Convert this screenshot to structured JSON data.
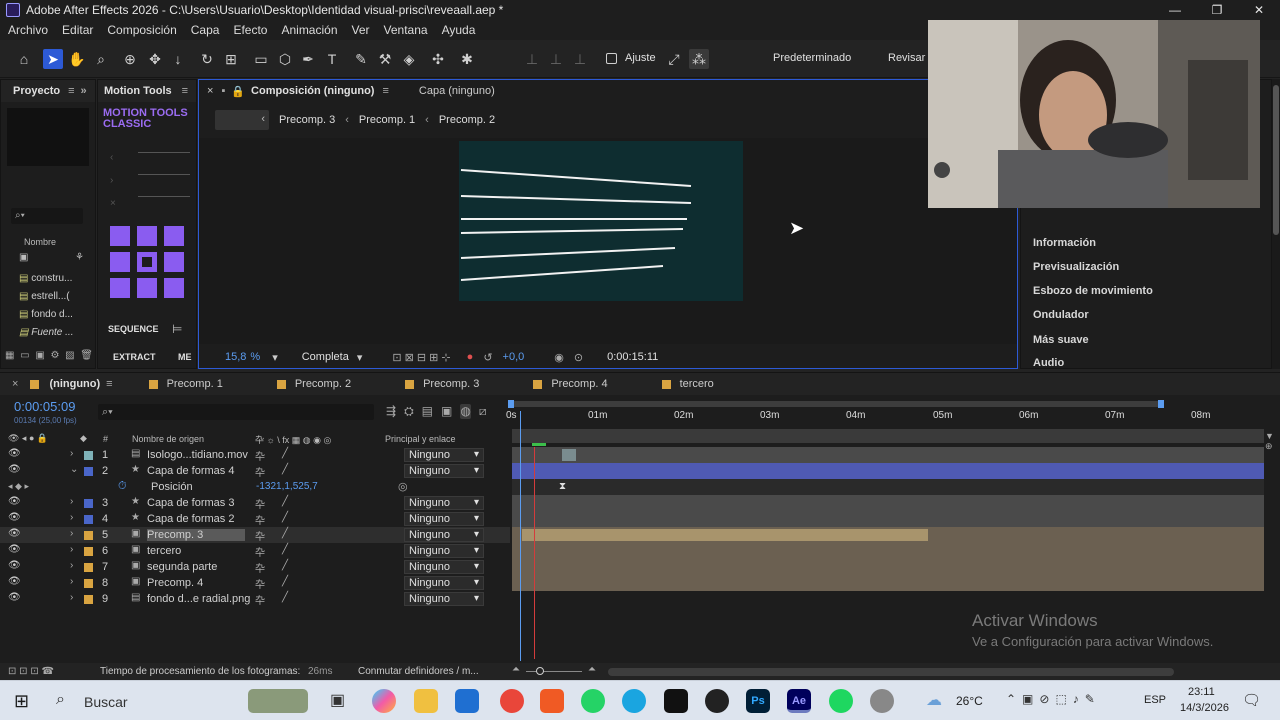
{
  "window": {
    "title": "Adobe After Effects 2026 - C:\\Users\\Usuario\\Desktop\\Identidad visual-prisci\\reveaall.aep *",
    "controls": [
      "—",
      "❐",
      "✕"
    ]
  },
  "menu": [
    "Archivo",
    "Editar",
    "Composición",
    "Capa",
    "Efecto",
    "Animación",
    "Ver",
    "Ventana",
    "Ayuda"
  ],
  "toolbar": {
    "snap_label": "Ajuste",
    "workspace": "Predeterminado",
    "review": "Revisar"
  },
  "project_panel": {
    "title": "Proyecto",
    "search_placeholder": "",
    "column": "Nombre",
    "items": [
      "constru...",
      "estrell...(",
      "fondo d...",
      "Fuente ..."
    ]
  },
  "motion_tools": {
    "title": "Motion Tools",
    "brand_line1": "MOTION TOOLS",
    "brand_line2": "CLASSIC",
    "sequence": "SEQUENCE",
    "extract": "EXTRACT",
    "me": "ME"
  },
  "composition": {
    "tab_title": "Composición (ninguno)",
    "layer_tab": "Capa (ninguno)",
    "breadcrumbs": [
      "Precomp. 3",
      "Precomp. 1",
      "Precomp. 2"
    ],
    "zoom": "15,8",
    "zoom_unit": "%",
    "resolution": "Completa",
    "exposure": "+0,0",
    "timecode": "0:00:15:11"
  },
  "effects_panel": {
    "items": [
      "Información",
      "Previsualización",
      "Esbozo de movimiento",
      "Ondulador",
      "Más suave",
      "Audio"
    ]
  },
  "timeline": {
    "tabs": [
      "(ninguno)",
      "Precomp. 1",
      "Precomp. 2",
      "Precomp. 3",
      "Precomp. 4",
      "tercero"
    ],
    "tab_colors": [
      "#e0a040",
      "#d9a441",
      "#d9a441",
      "#d9a441",
      "#d9a441",
      "#d9a441"
    ],
    "timecode": "0:00:05:09",
    "timecode_sub": "00134 (25,00 fps)",
    "col_source": "Nombre de origen",
    "col_hash": "#",
    "col_parent": "Principal y enlace",
    "ruler": [
      "0s",
      "01m",
      "02m",
      "03m",
      "04m",
      "05m",
      "06m",
      "07m",
      "08m"
    ],
    "layers": [
      {
        "num": "1",
        "name": "Isologo...tidiano.mov",
        "color": "#7fb2b8",
        "parent": "Ninguno",
        "icon": "footage-icon"
      },
      {
        "num": "2",
        "name": "Capa de formas 4",
        "color": "#4a66c9",
        "parent": "Ninguno",
        "icon": "star-icon"
      },
      {
        "num": "3",
        "name": "Capa de formas 3",
        "color": "#4a66c9",
        "parent": "Ninguno",
        "icon": "star-icon"
      },
      {
        "num": "4",
        "name": "Capa de formas 2",
        "color": "#4a66c9",
        "parent": "Ninguno",
        "icon": "star-icon"
      },
      {
        "num": "5",
        "name": "Precomp. 3",
        "color": "#d9a441",
        "parent": "Ninguno",
        "icon": "comp-icon"
      },
      {
        "num": "6",
        "name": "tercero",
        "color": "#d9a441",
        "parent": "Ninguno",
        "icon": "comp-icon"
      },
      {
        "num": "7",
        "name": "segunda parte",
        "color": "#d9a441",
        "parent": "Ninguno",
        "icon": "comp-icon"
      },
      {
        "num": "8",
        "name": "Precomp. 4",
        "color": "#d9a441",
        "parent": "Ninguno",
        "icon": "comp-icon"
      },
      {
        "num": "9",
        "name": "fondo d...e radial.png",
        "color": "#d9a441",
        "parent": "Ninguno",
        "icon": "image-icon"
      }
    ],
    "position_prop": {
      "label": "Posición",
      "value": "-1321,1,525,7"
    },
    "status": "Tiempo de procesamiento de los fotogramas:",
    "status_value": "26ms",
    "toggle": "Conmutar definidores / m..."
  },
  "activation": {
    "title": "Activar Windows",
    "subtitle": "Ve a Configuración para activar Windows."
  },
  "taskbar": {
    "search": "Buscar",
    "weather": "26°C",
    "lang": "ESP",
    "time": "23:11",
    "date": "14/3/2026"
  }
}
